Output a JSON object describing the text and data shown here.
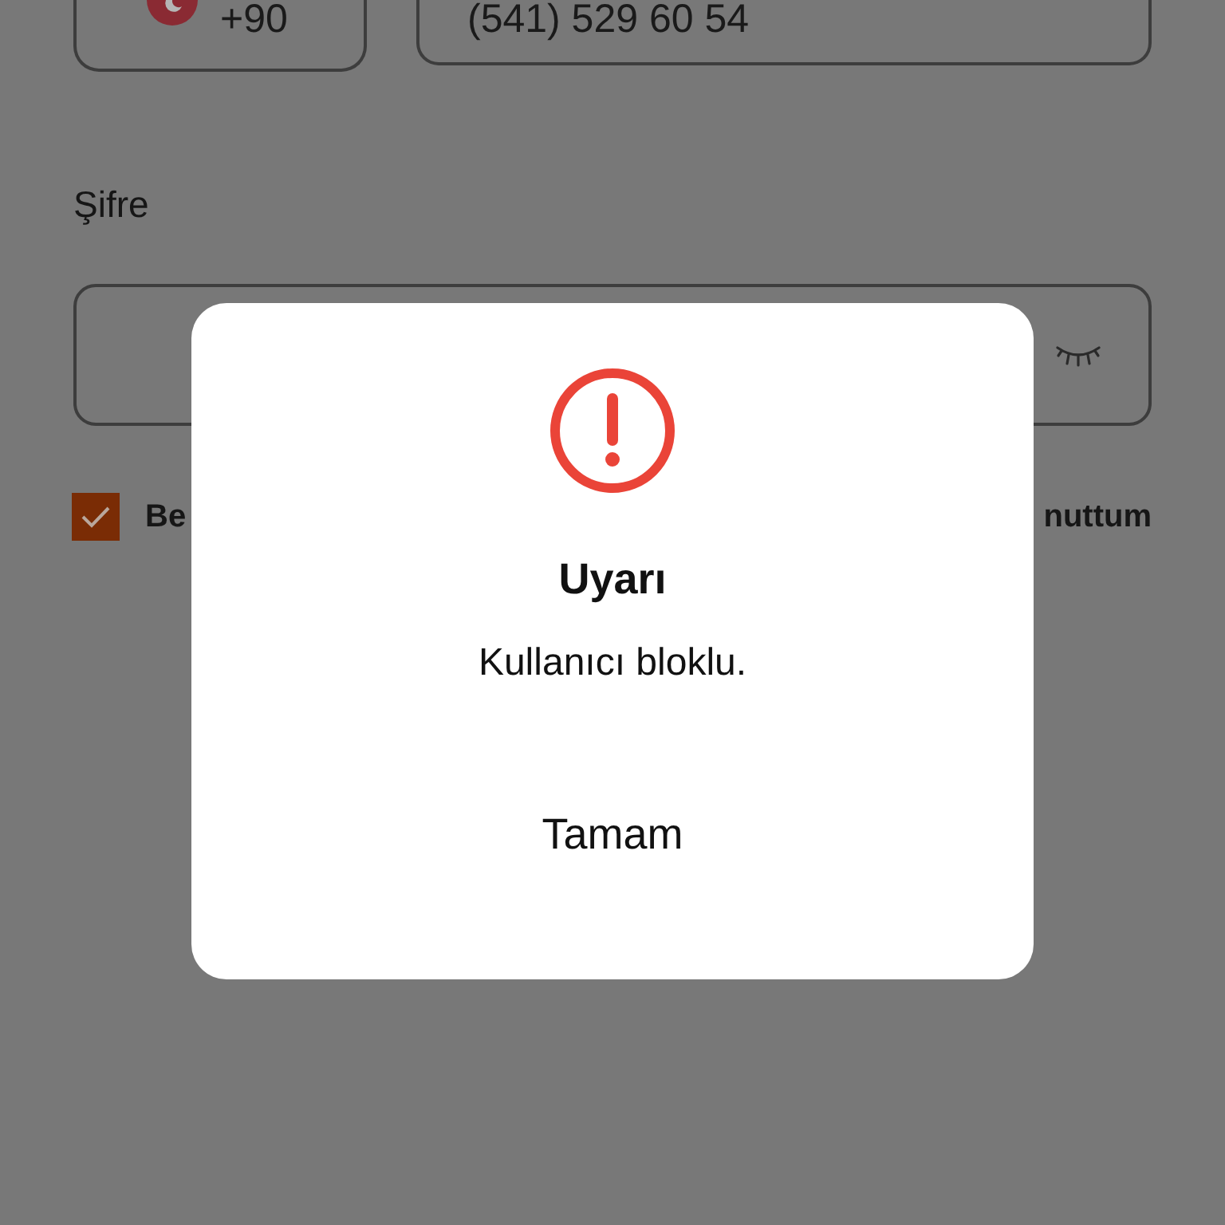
{
  "phone": {
    "country_code": "+90",
    "number": "(541) 529 60 54"
  },
  "password": {
    "label": "Şifre"
  },
  "remember": {
    "label": "Be",
    "checked": true
  },
  "forgot_link": "nuttum",
  "dialog": {
    "title": "Uyarı",
    "message": "Kullanıcı bloklu.",
    "button": "Tamam"
  }
}
